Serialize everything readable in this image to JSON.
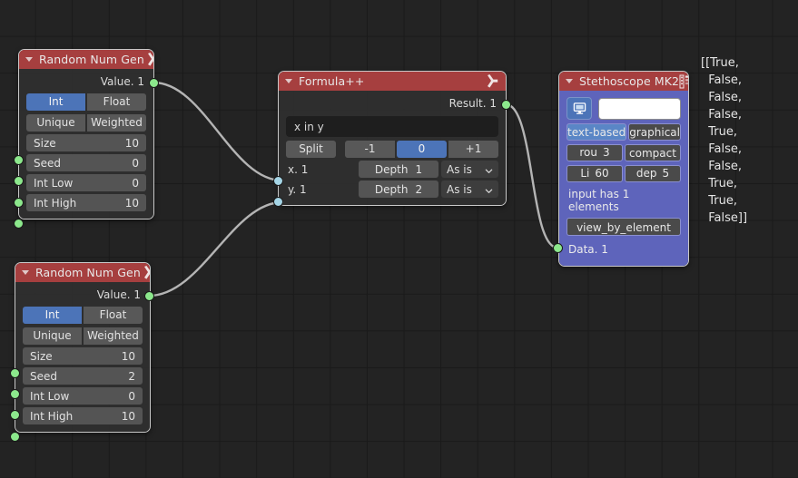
{
  "editor": {
    "name": "blender-node-editor",
    "background_color": "#232323",
    "grid_color": "#1a1a1a",
    "link_color": "#b4b4b4",
    "accent_blue": "#4c74b8",
    "header_red": "#a63f3f",
    "purple_body": "#5e64bb",
    "socket_green": "#8ce88c",
    "socket_blue": "#a5d5e6"
  },
  "nodes": {
    "random1": {
      "title": "Random Num Gen",
      "header_icon": "armature-icon",
      "collapse_icon": "triangle-down-icon",
      "output_label": "Value. 1",
      "type_buttons": [
        {
          "label": "Int",
          "selected": true
        },
        {
          "label": "Float",
          "selected": false
        }
      ],
      "mode_buttons": [
        {
          "label": "Unique",
          "selected": false
        },
        {
          "label": "Weighted",
          "selected": false
        }
      ],
      "properties": [
        {
          "name": "Size",
          "value": "10"
        },
        {
          "name": "Seed",
          "value": "0"
        },
        {
          "name": "Int Low",
          "value": "0"
        },
        {
          "name": "Int High",
          "value": "10"
        }
      ]
    },
    "random2": {
      "title": "Random Num Gen",
      "header_icon": "armature-icon",
      "collapse_icon": "triangle-down-icon",
      "output_label": "Value. 1",
      "type_buttons": [
        {
          "label": "Int",
          "selected": true
        },
        {
          "label": "Float",
          "selected": false
        }
      ],
      "mode_buttons": [
        {
          "label": "Unique",
          "selected": false
        },
        {
          "label": "Weighted",
          "selected": false
        }
      ],
      "properties": [
        {
          "name": "Size",
          "value": "10"
        },
        {
          "name": "Seed",
          "value": "2"
        },
        {
          "name": "Int Low",
          "value": "0"
        },
        {
          "name": "Int High",
          "value": "10"
        }
      ]
    },
    "formula": {
      "title": "Formula++",
      "header_icon": "armature-icon",
      "collapse_icon": "triangle-down-icon",
      "output_label": "Result. 1",
      "expression": "x in y",
      "split_label": "Split",
      "offset_buttons": [
        {
          "label": "-1",
          "selected": false
        },
        {
          "label": "0",
          "selected": true
        },
        {
          "label": "+1",
          "selected": false
        }
      ],
      "inputs": [
        {
          "socket": "x. 1",
          "depth_label": "Depth",
          "depth_value": "1",
          "mode": "As is"
        },
        {
          "socket": "y. 1",
          "depth_label": "Depth",
          "depth_value": "2",
          "mode": "As is"
        }
      ]
    },
    "stethoscope": {
      "title": "Stethoscope MK2",
      "header_icon": "list-icon",
      "collapse_icon": "triangle-down-icon",
      "monitor_icon": "monitor-icon",
      "color_swatch": "#ffffff",
      "view_buttons": [
        {
          "label": "text-based",
          "selected": true
        },
        {
          "label": "graphical",
          "selected": false
        }
      ],
      "round_row": [
        {
          "label": "rou",
          "value": "3"
        },
        {
          "label": "compact",
          "value": ""
        }
      ],
      "limit_row": [
        {
          "label": "Li",
          "value": "60"
        },
        {
          "label": "dep",
          "value": "5"
        }
      ],
      "info_text": "input has 1 elements",
      "view_by_element_label": "view_by_element",
      "input_label": "Data. 1"
    }
  },
  "readout": {
    "name": "stethoscope-text-output",
    "lines": [
      "[[True,",
      "False,",
      "False,",
      "False,",
      "True,",
      "False,",
      "False,",
      "True,",
      "True,",
      "False]]"
    ],
    "text": "[[True,\n  False,\n  False,\n  False,\n  True,\n  False,\n  False,\n  True,\n  True,\n  False]]",
    "values": [
      true,
      false,
      false,
      false,
      true,
      false,
      false,
      true,
      true,
      false
    ]
  }
}
